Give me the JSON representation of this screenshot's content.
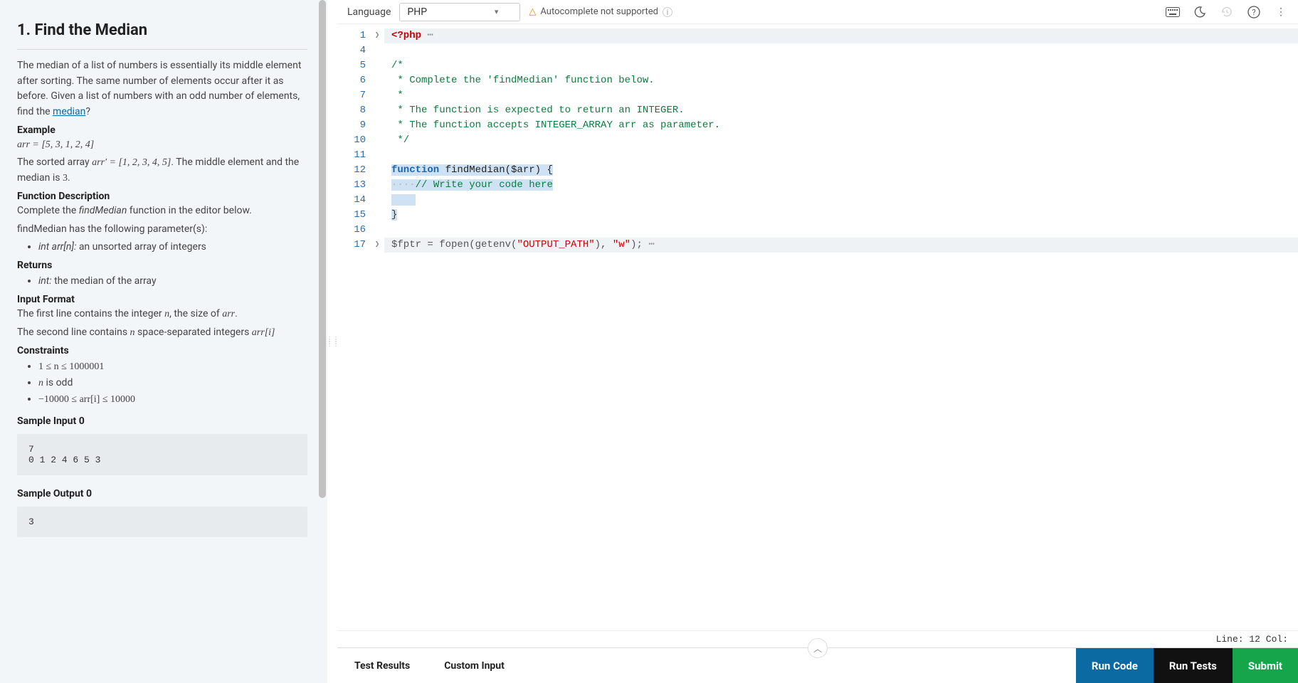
{
  "problem": {
    "title": "1. Find the Median",
    "desc_prefix": "The median of a list of numbers is essentially its middle element after sorting. The same number of elements occur after it as before. Given a list of numbers with an odd number of elements, find the ",
    "desc_link": "median",
    "desc_suffix": "?",
    "example_h": "Example",
    "example_arr": "arr = [5, 3, 1, 2, 4]",
    "example_sorted_a": "The sorted array ",
    "example_sorted_b": "arr′ = [1, 2, 3, 4, 5]",
    "example_sorted_c": ". The middle element and the median is ",
    "example_sorted_d": "3",
    "example_sorted_e": ".",
    "fn_desc_h": "Function Description",
    "fn_desc_1a": "Complete the ",
    "fn_desc_1b": "findMedian",
    "fn_desc_1c": " function in the editor below.",
    "fn_desc_2": "findMedian has the following parameter(s):",
    "param_label": "int arr[n]:",
    "param_text": " an unsorted array of integers",
    "returns_h": "Returns",
    "returns_label": "int:",
    "returns_text": " the median of the array",
    "input_h": "Input Format",
    "input_1a": "The first line contains the integer ",
    "input_1b": "n",
    "input_1c": ", the size of ",
    "input_1d": "arr",
    "input_1e": ".",
    "input_2a": "The second line contains ",
    "input_2b": "n",
    "input_2c": " space-separated integers ",
    "input_2d": "arr[i]",
    "constraints_h": "Constraints",
    "c1": "1 ≤ n ≤ 1000001",
    "c2a": "n",
    "c2b": " is odd",
    "c3": "−10000 ≤ arr[i] ≤ 10000",
    "sample_in_h": "Sample Input 0",
    "sample_in": "7\n0 1 2 4 6 5 3",
    "sample_out_h": "Sample Output 0",
    "sample_out": "3"
  },
  "toolbar": {
    "lang_label": "Language",
    "lang_value": "PHP",
    "warn_text": "Autocomplete not supported"
  },
  "editor": {
    "line_numbers": [
      "1",
      "4",
      "5",
      "6",
      "7",
      "8",
      "9",
      "10",
      "11",
      "12",
      "13",
      "14",
      "15",
      "16",
      "17"
    ],
    "status": "Line: 12 Col:"
  },
  "code": {
    "l1": "<?php",
    "l5": "/*",
    "l6": " * Complete the 'findMedian' function below.",
    "l7": " *",
    "l8": " * The function is expected to return an INTEGER.",
    "l9": " * The function accepts INTEGER_ARRAY arr as parameter.",
    "l10": " */",
    "l12_kw": "function",
    "l12_fn": " findMedian($arr) {",
    "l13_ws": "····",
    "l13": "// Write your code here",
    "l15": "}",
    "l17_a": "$fptr = fopen(getenv(",
    "l17_s1": "\"OUTPUT_PATH\"",
    "l17_b": "), ",
    "l17_s2": "\"w\"",
    "l17_c": ");"
  },
  "bottom": {
    "tab_results": "Test Results",
    "tab_custom": "Custom Input",
    "run_code": "Run Code",
    "run_tests": "Run Tests",
    "submit": "Submit"
  }
}
